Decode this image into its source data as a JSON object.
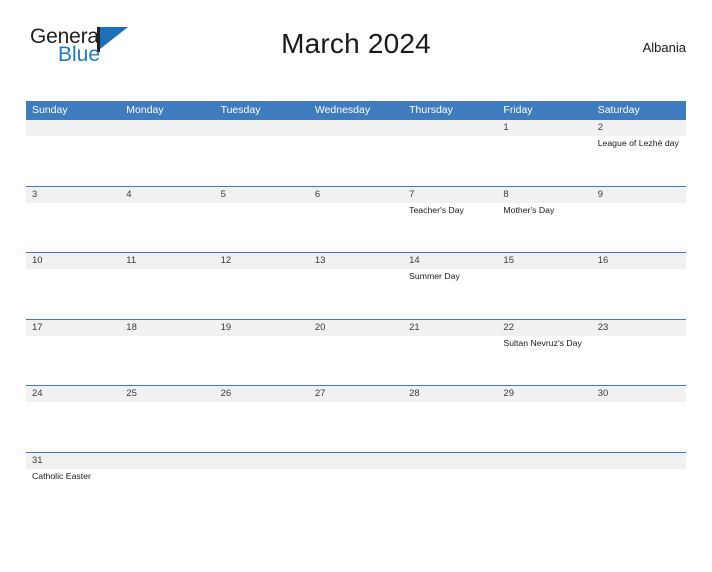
{
  "brand": {
    "word_one": "General",
    "word_two": "Blue",
    "flag_icon": "triangle-flag-icon",
    "accent_color": "#1d6fb8"
  },
  "header": {
    "title": "March 2024",
    "region": "Albania"
  },
  "calendar": {
    "header_bg": "#3f7cbf",
    "band_bg": "#f1f1f1",
    "day_names": [
      "Sunday",
      "Monday",
      "Tuesday",
      "Wednesday",
      "Thursday",
      "Friday",
      "Saturday"
    ],
    "weeks": [
      [
        {
          "day": "",
          "events": []
        },
        {
          "day": "",
          "events": []
        },
        {
          "day": "",
          "events": []
        },
        {
          "day": "",
          "events": []
        },
        {
          "day": "",
          "events": []
        },
        {
          "day": "1",
          "events": []
        },
        {
          "day": "2",
          "events": [
            "League of Lezhë day"
          ]
        }
      ],
      [
        {
          "day": "3",
          "events": []
        },
        {
          "day": "4",
          "events": []
        },
        {
          "day": "5",
          "events": []
        },
        {
          "day": "6",
          "events": []
        },
        {
          "day": "7",
          "events": [
            "Teacher's Day"
          ]
        },
        {
          "day": "8",
          "events": [
            "Mother's Day"
          ]
        },
        {
          "day": "9",
          "events": []
        }
      ],
      [
        {
          "day": "10",
          "events": []
        },
        {
          "day": "11",
          "events": []
        },
        {
          "day": "12",
          "events": []
        },
        {
          "day": "13",
          "events": []
        },
        {
          "day": "14",
          "events": [
            "Summer Day"
          ]
        },
        {
          "day": "15",
          "events": []
        },
        {
          "day": "16",
          "events": []
        }
      ],
      [
        {
          "day": "17",
          "events": []
        },
        {
          "day": "18",
          "events": []
        },
        {
          "day": "19",
          "events": []
        },
        {
          "day": "20",
          "events": []
        },
        {
          "day": "21",
          "events": []
        },
        {
          "day": "22",
          "events": [
            "Sultan Nevruz's Day"
          ]
        },
        {
          "day": "23",
          "events": []
        }
      ],
      [
        {
          "day": "24",
          "events": []
        },
        {
          "day": "25",
          "events": []
        },
        {
          "day": "26",
          "events": []
        },
        {
          "day": "27",
          "events": []
        },
        {
          "day": "28",
          "events": []
        },
        {
          "day": "29",
          "events": []
        },
        {
          "day": "30",
          "events": []
        }
      ],
      [
        {
          "day": "31",
          "events": [
            "Catholic Easter"
          ]
        },
        {
          "day": "",
          "events": []
        },
        {
          "day": "",
          "events": []
        },
        {
          "day": "",
          "events": []
        },
        {
          "day": "",
          "events": []
        },
        {
          "day": "",
          "events": []
        },
        {
          "day": "",
          "events": []
        }
      ]
    ]
  }
}
